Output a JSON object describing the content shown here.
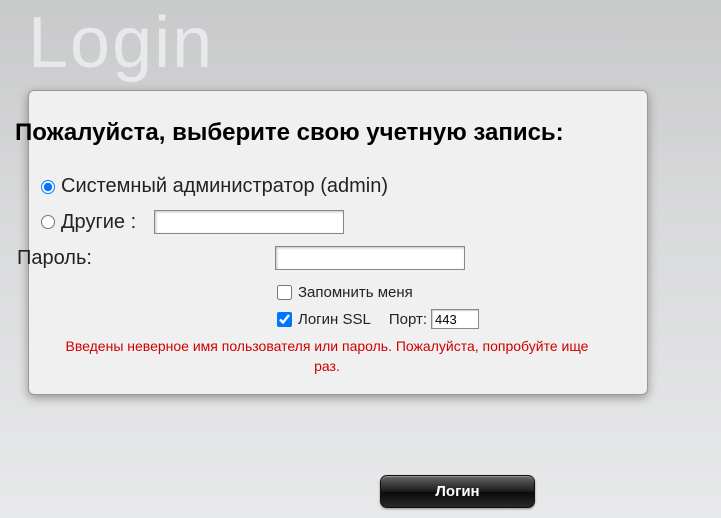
{
  "title": "Login",
  "heading": "Пожалуйста, выберите свою учетную запись:",
  "account": {
    "admin_label": "Системный администратор (admin)",
    "other_label": "Другие :",
    "other_value": ""
  },
  "password": {
    "label": "Пароль:",
    "value": ""
  },
  "remember_label": "Запомнить меня",
  "ssl": {
    "label": "Логин SSL",
    "port_label": "Порт:",
    "port_value": "443",
    "checked": true
  },
  "error": "Введены неверное имя пользователя или пароль. Пожалуйста, попробуйте ище раз.",
  "login_button": "Логин"
}
